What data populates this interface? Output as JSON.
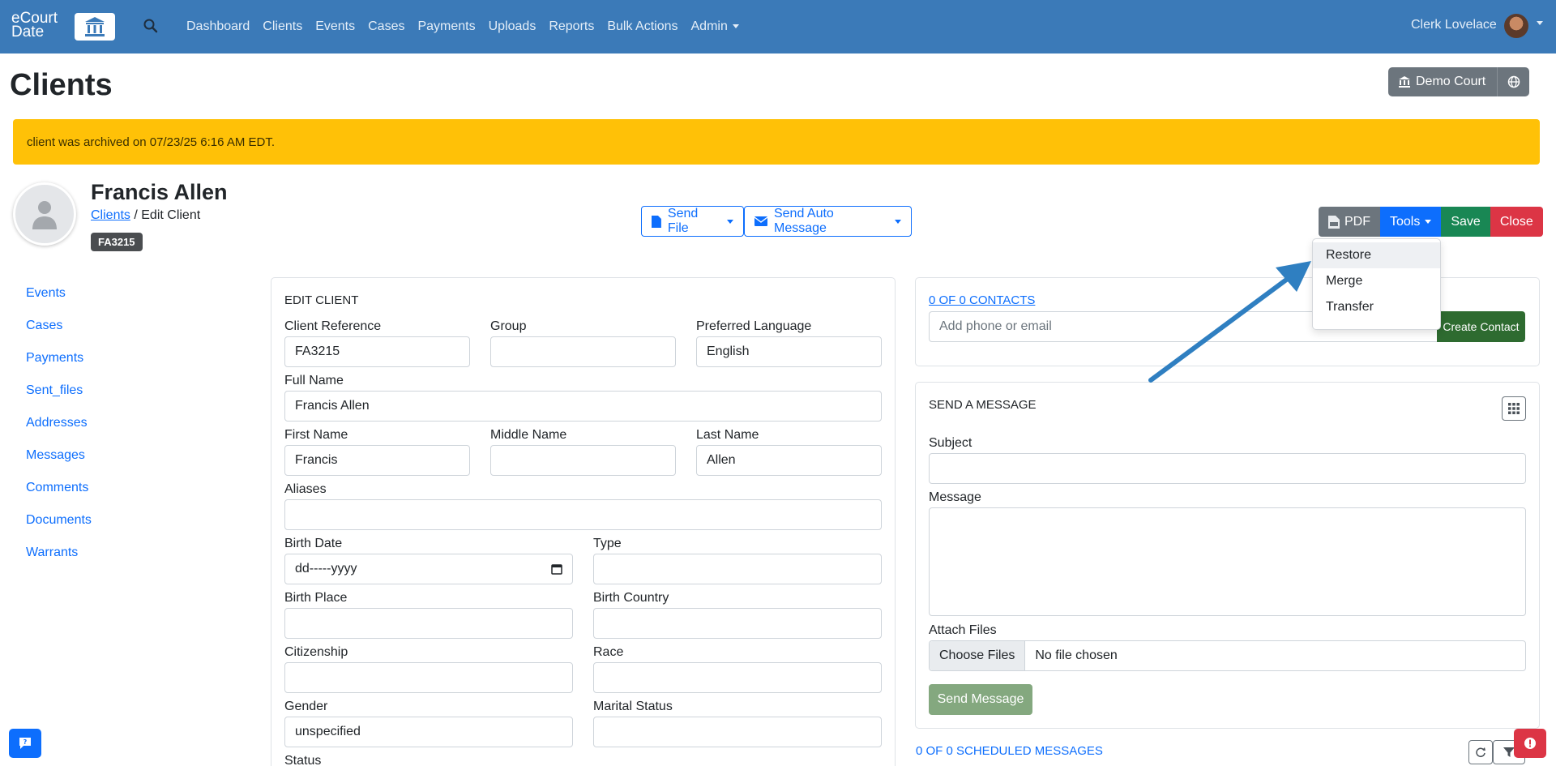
{
  "navbar": {
    "logo_text": "eCourt Date",
    "links": [
      "Dashboard",
      "Clients",
      "Events",
      "Cases",
      "Payments",
      "Uploads",
      "Reports",
      "Bulk Actions",
      "Admin"
    ],
    "user": "Clerk Lovelace"
  },
  "page": {
    "title": "Clients",
    "court_button": "Demo Court"
  },
  "alert": {
    "text": "client was archived on 07/23/25 6:16 AM EDT."
  },
  "client": {
    "name": "Francis Allen",
    "breadcrumb_link": "Clients",
    "breadcrumb_rest": " / Edit Client",
    "badge": "FA3215"
  },
  "header_buttons": {
    "send_file": "Send File",
    "send_auto": "Send Auto Message",
    "pdf": "PDF",
    "tools": "Tools",
    "save": "Save",
    "close": "Close"
  },
  "tools_menu": [
    "Restore",
    "Merge",
    "Transfer"
  ],
  "sidebar": [
    "Events",
    "Cases",
    "Payments",
    "Sent_files",
    "Addresses",
    "Messages",
    "Comments",
    "Documents",
    "Warrants"
  ],
  "edit_client": {
    "title": "EDIT CLIENT",
    "labels": {
      "client_reference": "Client Reference",
      "group": "Group",
      "preferred_language": "Preferred Language",
      "full_name": "Full Name",
      "first_name": "First Name",
      "middle_name": "Middle Name",
      "last_name": "Last Name",
      "aliases": "Aliases",
      "birth_date": "Birth Date",
      "type": "Type",
      "birth_place": "Birth Place",
      "birth_country": "Birth Country",
      "citizenship": "Citizenship",
      "race": "Race",
      "gender": "Gender",
      "marital_status": "Marital Status",
      "status": "Status"
    },
    "values": {
      "client_reference": "FA3215",
      "preferred_language": "English",
      "full_name": "Francis Allen",
      "first_name": "Francis",
      "last_name": "Allen",
      "birth_date": "dd-----yyyy",
      "gender": "unspecified"
    }
  },
  "contacts": {
    "link": "0 OF 0 CONTACTS",
    "placeholder": "Add phone or email",
    "create_button": "Create Contact"
  },
  "message": {
    "title": "SEND A MESSAGE",
    "subject_label": "Subject",
    "message_label": "Message",
    "attach_label": "Attach Files",
    "choose_button": "Choose Files",
    "file_status": "No file chosen",
    "send_button": "Send Message"
  },
  "scheduled": {
    "text": "0 OF 0 SCHEDULED MESSAGES"
  },
  "colors": {
    "navbar": "#3b7ab8",
    "alert": "#ffc107",
    "primary": "#0d6efd",
    "save": "#198754",
    "close": "#dc3545",
    "create_contact": "#2e6b30",
    "send_message": "#84a87f",
    "annotation_arrow": "#2f7fc1"
  }
}
